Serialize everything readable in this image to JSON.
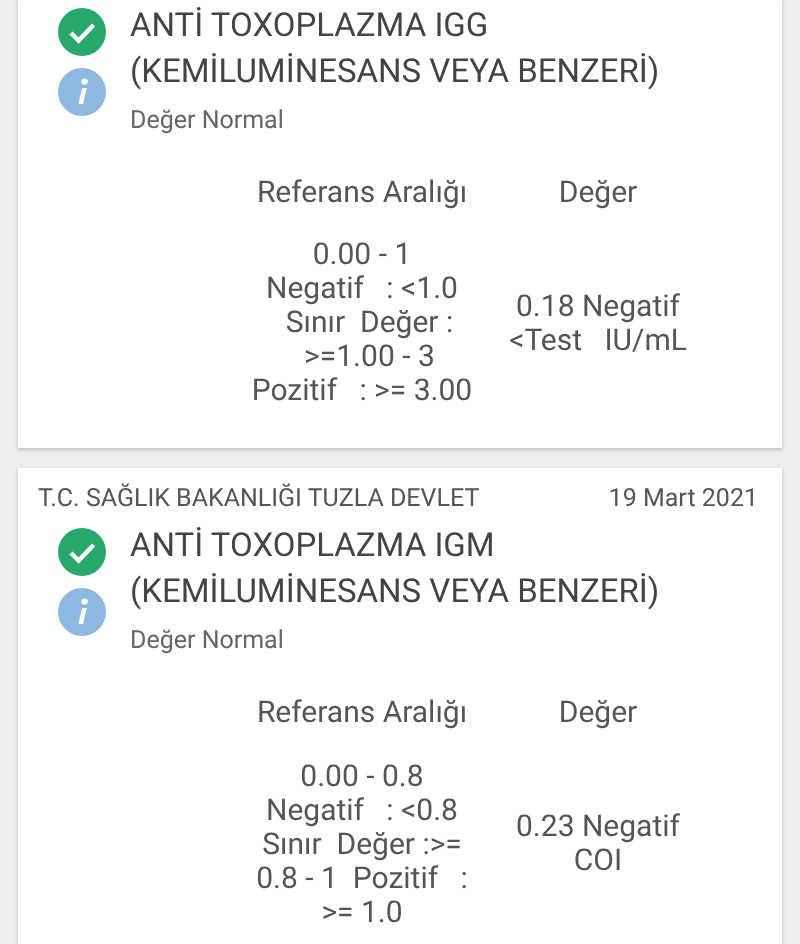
{
  "results": [
    {
      "normal": true,
      "title": "ANTİ TOXOPLAZMA IGG (KEMİLUMİNESANS VEYA BENZERİ)",
      "note": "Değer Normal",
      "columns": [
        "Referans Aralığı",
        "Değer"
      ],
      "range_lines": [
        "0.00 - 1",
        "Negatif   : <1.0",
        "  Sınır  Değer :",
        "  >=1.00 - 3",
        "Pozitif   : >= 3.00"
      ],
      "value_lines": [
        "0.18 Negatif",
        "<Test   IU/mL"
      ]
    },
    {
      "source": "T.C. SAĞLIK BAKANLIĞI TUZLA DEVLET",
      "date": "19 Mart 2021",
      "normal": true,
      "title": "ANTİ TOXOPLAZMA IGM (KEMİLUMİNESANS VEYA BENZERİ)",
      "note": "Değer Normal",
      "columns": [
        "Referans Aralığı",
        "Değer"
      ],
      "range_lines": [
        "0.00 - 0.8",
        "Negatif   : <0.8",
        "Sınır  Değer :>=",
        "0.8 - 1  Pozitif   :",
        ">= 1.0"
      ],
      "value_lines": [
        "0.23 Negatif",
        "COI"
      ]
    }
  ]
}
